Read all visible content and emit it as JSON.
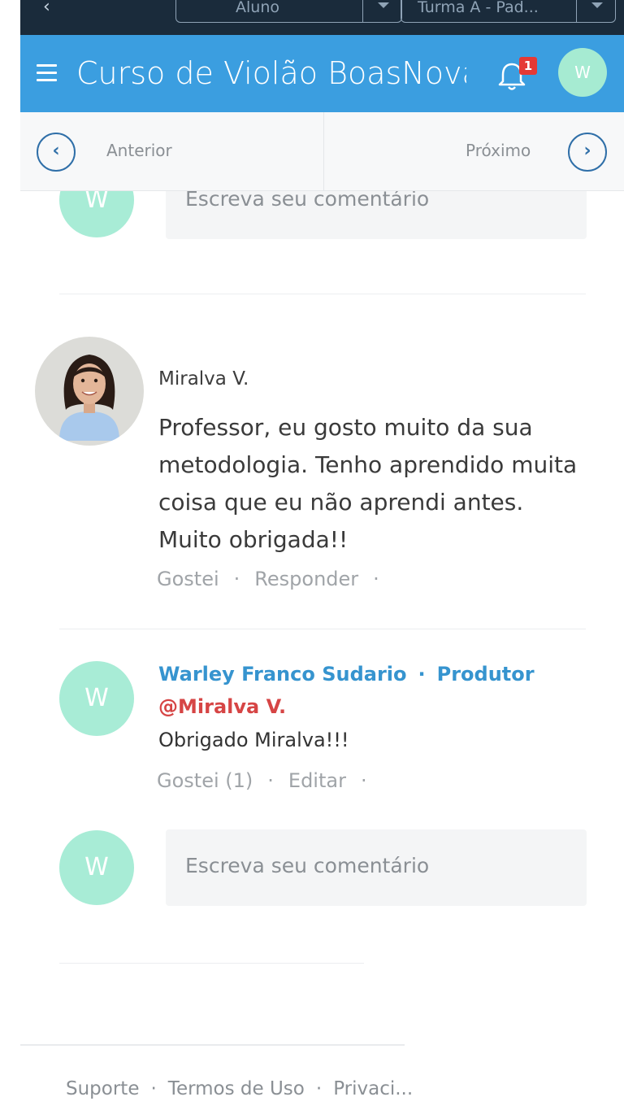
{
  "topbar": {
    "back_icon": "chevron-left-icon",
    "role_select": "Aluno",
    "class_select": "Turma A - Pad..."
  },
  "appbar": {
    "menu_icon": "hamburger-menu-icon",
    "title": "Curso de Violão BoasNova",
    "notifications_count": "1",
    "avatar_initial": "W",
    "color": "#3b9ee0"
  },
  "nav": {
    "prev_label": "Anterior",
    "next_label": "Próximo",
    "prev_icon": "‹",
    "next_icon": "›"
  },
  "comment_top": {
    "avatar_initial": "W",
    "placeholder": "Escreva seu comentário"
  },
  "comment": {
    "author": "Miralva V.",
    "text": "Professor, eu gosto muito da sua metodologia. Tenho aprendido muita coisa que eu não aprendi antes. Muito obrigada!!",
    "like_label": "Gostei",
    "reply_label": "Responder"
  },
  "reply": {
    "avatar_initial": "W",
    "author": "Warley Franco Sudario",
    "role": "Produtor",
    "mention": "@Miralva V.",
    "text": "Obrigado Miralva!!!",
    "like_label": "Gostei (1)",
    "edit_label": "Editar"
  },
  "comment_bottom": {
    "avatar_initial": "W",
    "placeholder": "Escreva seu comentário"
  },
  "footer": {
    "support": "Suporte",
    "terms": "Termos de Uso",
    "privacy": "Privaci..."
  }
}
